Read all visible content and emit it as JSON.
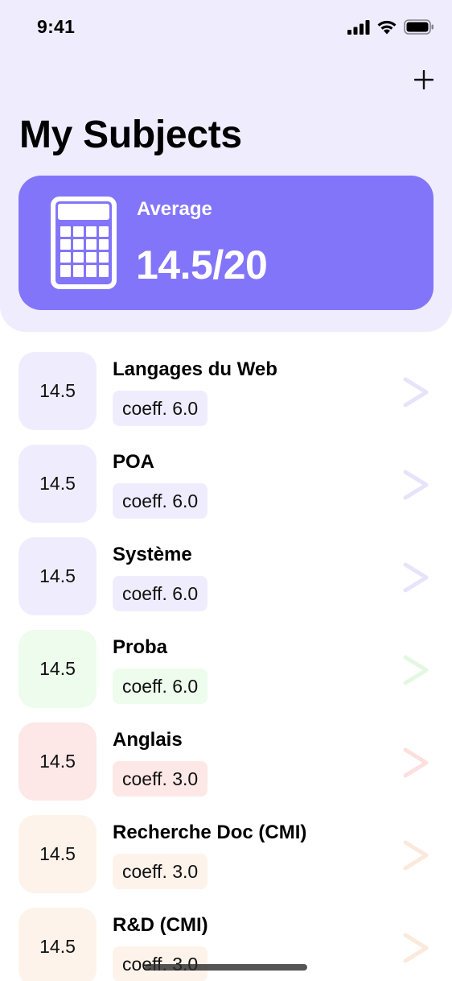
{
  "status_bar": {
    "time": "9:41"
  },
  "header": {
    "add_icon": "plus-icon",
    "title": "My Subjects"
  },
  "average_card": {
    "icon": "calculator-icon",
    "label": "Average",
    "value": "14.5/20"
  },
  "subjects": [
    {
      "name": "Langages du Web",
      "grade": "14.5",
      "coeff": "coeff. 6.0",
      "tint": "#efedfd",
      "chevron_color": "#e6e3fb"
    },
    {
      "name": "POA",
      "grade": "14.5",
      "coeff": "coeff. 6.0",
      "tint": "#efedfd",
      "chevron_color": "#e6e3fb"
    },
    {
      "name": "Système",
      "grade": "14.5",
      "coeff": "coeff. 6.0",
      "tint": "#efedfd",
      "chevron_color": "#e6e3fb"
    },
    {
      "name": "Proba",
      "grade": "14.5",
      "coeff": "coeff. 6.0",
      "tint": "#edfcec",
      "chevron_color": "#e3f8e1"
    },
    {
      "name": "Anglais",
      "grade": "14.5",
      "coeff": "coeff. 3.0",
      "tint": "#fde8e7",
      "chevron_color": "#fbe0de"
    },
    {
      "name": "Recherche Doc (CMI)",
      "grade": "14.5",
      "coeff": "coeff. 3.0",
      "tint": "#fdf3ea",
      "chevron_color": "#fbe9dc"
    },
    {
      "name": "R&D (CMI)",
      "grade": "14.5",
      "coeff": "coeff. 3.0",
      "tint": "#fdf3ea",
      "chevron_color": "#fbe9dc"
    }
  ],
  "colors": {
    "accent": "#8375fa",
    "header_bg": "#efedfd"
  }
}
